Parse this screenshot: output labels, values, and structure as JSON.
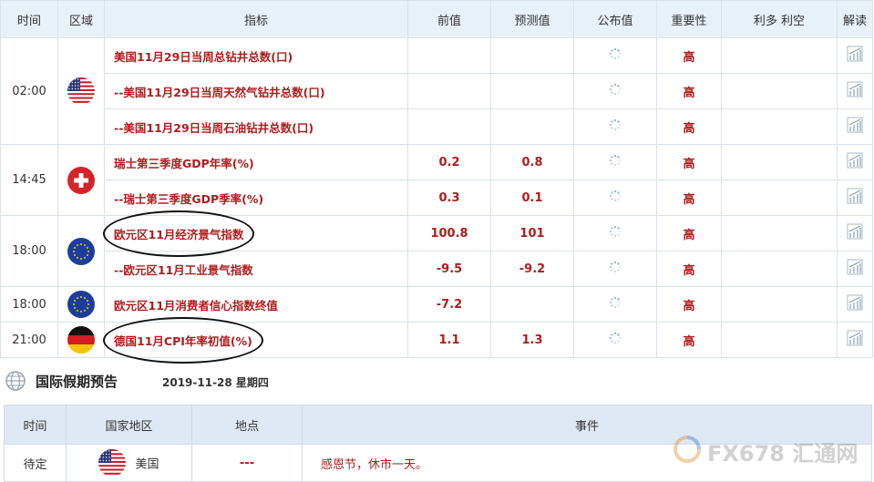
{
  "table": {
    "headers": {
      "time": "时间",
      "region": "区域",
      "indicator": "指标",
      "previous": "前值",
      "forecast": "预测值",
      "published": "公布值",
      "importance": "重要性",
      "impact": "利多 利空",
      "interpret": "解读"
    },
    "groups": [
      {
        "time": "02:00",
        "flag": "us-flag-icon",
        "rows": [
          {
            "indicator": "美国11月29日当周总钻井总数(口)",
            "previous": "",
            "forecast": "",
            "importance": "高"
          },
          {
            "indicator": "--美国11月29日当周天然气钻井总数(口)",
            "previous": "",
            "forecast": "",
            "importance": "高"
          },
          {
            "indicator": "--美国11月29日当周石油钻井总数(口)",
            "previous": "",
            "forecast": "",
            "importance": "高"
          }
        ]
      },
      {
        "time": "14:45",
        "flag": "swiss-flag-icon",
        "rows": [
          {
            "indicator": "瑞士第三季度GDP年率(%)",
            "previous": "0.2",
            "forecast": "0.8",
            "importance": "高"
          },
          {
            "indicator": "--瑞士第三季度GDP季率(%)",
            "previous": "0.3",
            "forecast": "0.1",
            "importance": "高"
          }
        ]
      },
      {
        "time": "18:00",
        "flag": "eu-flag-icon",
        "rows": [
          {
            "indicator": "欧元区11月经济景气指数",
            "previous": "100.8",
            "forecast": "101",
            "importance": "高",
            "circled": true
          },
          {
            "indicator": "--欧元区11月工业景气指数",
            "previous": "-9.5",
            "forecast": "-9.2",
            "importance": "高"
          }
        ]
      },
      {
        "time": "18:00",
        "flag": "eu-flag-icon",
        "rows": [
          {
            "indicator": "欧元区11月消费者信心指数终值",
            "previous": "-7.2",
            "forecast": "",
            "importance": "高"
          }
        ]
      },
      {
        "time": "21:00",
        "flag": "germany-flag-icon",
        "rows": [
          {
            "indicator": "德国11月CPI年率初值(%)",
            "previous": "1.1",
            "forecast": "1.3",
            "importance": "高",
            "circled": true
          }
        ]
      }
    ]
  },
  "holiday": {
    "title": "国际假期预告",
    "date": "2019-11-28 星期四",
    "headers": {
      "time": "时间",
      "country": "国家地区",
      "place": "地点",
      "event": "事件"
    },
    "rows": [
      {
        "time": "待定",
        "flag": "us-flag-icon",
        "country": "美国",
        "place": "---",
        "event": "感恩节，休市一天。"
      }
    ]
  },
  "watermark": {
    "text": "FX678 汇通网"
  },
  "colors": {
    "accent_red": "#b01c1c",
    "header_bg": "#e8f0f8",
    "border": "#d9e2ea"
  }
}
